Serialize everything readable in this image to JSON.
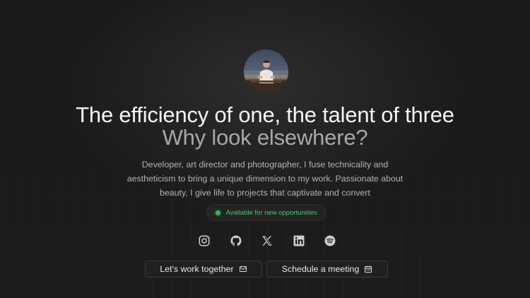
{
  "hero": {
    "title": "The efficiency of one, the talent of three",
    "subtitle": "Why look elsewhere?",
    "description_lines": [
      "Developer, art director and photographer, I fuse technicality and",
      "aestheticism to bring a unique dimension to my work. Passionate about",
      "beauty, I give life to projects that captivate and convert"
    ],
    "status": {
      "label": "Available for new opportunities",
      "color": "#2fbf55"
    }
  },
  "socials": [
    {
      "icon": "instagram-icon"
    },
    {
      "icon": "github-icon"
    },
    {
      "icon": "x-icon"
    },
    {
      "icon": "linkedin-icon"
    },
    {
      "icon": "spotify-icon"
    }
  ],
  "actions": {
    "work_label": "Let's work together",
    "work_icon": "mail-icon",
    "meeting_label": "Schedule a meeting",
    "meeting_icon": "calendar-icon"
  },
  "colors": {
    "background": "#1b1b1b",
    "title": "#f5f5f5",
    "subtitle": "#a8a8a8",
    "status_text": "#45c86a"
  }
}
